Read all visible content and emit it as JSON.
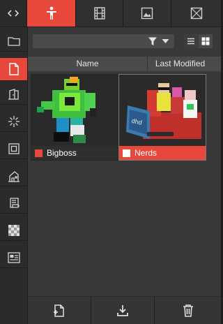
{
  "colors": {
    "accent": "#e8473c",
    "panel": "#383838",
    "sidebar": "#2b2b2b"
  },
  "top_tabs": [
    {
      "icon": "person-icon",
      "active": true
    },
    {
      "icon": "film-icon",
      "active": false
    },
    {
      "icon": "image-icon",
      "active": false
    },
    {
      "icon": "crossed-box-icon",
      "active": false
    }
  ],
  "sidebar": {
    "collapse_icon": "collapse-icon",
    "items": [
      {
        "icon": "folder-icon",
        "active": false
      },
      {
        "icon": "document-icon",
        "active": true
      },
      {
        "icon": "door-icon",
        "active": false
      },
      {
        "icon": "light-icon",
        "active": false
      },
      {
        "icon": "frame-icon",
        "active": false
      },
      {
        "icon": "house-icon",
        "active": false
      },
      {
        "icon": "scroll-icon",
        "active": false
      },
      {
        "icon": "checker-icon",
        "active": false
      },
      {
        "icon": "card-icon",
        "active": false
      }
    ]
  },
  "search": {
    "placeholder": "",
    "value": ""
  },
  "columns": {
    "name": "Name",
    "last_modified": "Last Modified"
  },
  "items": [
    {
      "name": "Bigboss",
      "swatch": "#e8473c",
      "selected": false
    },
    {
      "name": "Nerds",
      "swatch": "#ffffff",
      "selected": true
    }
  ],
  "bottom_actions": [
    {
      "icon": "new-file-icon"
    },
    {
      "icon": "download-icon"
    },
    {
      "icon": "trash-icon"
    }
  ]
}
